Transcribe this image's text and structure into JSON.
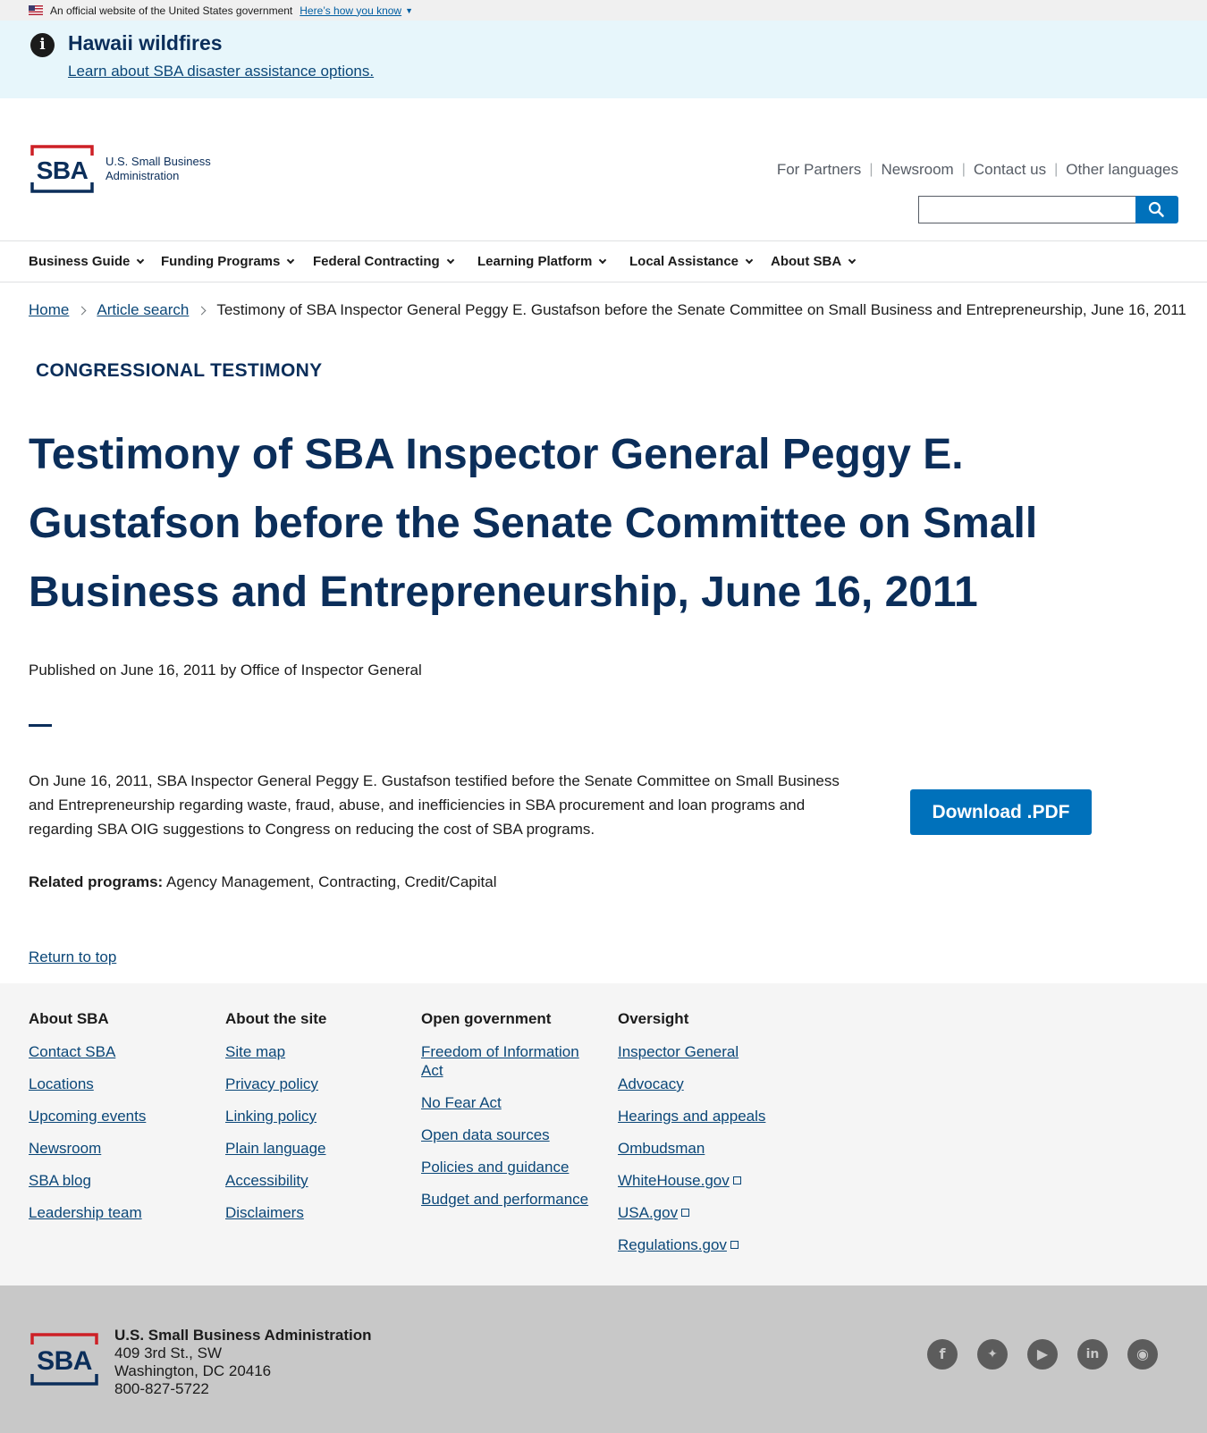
{
  "gov_banner": {
    "text": "An official website of the United States government",
    "link": "Here’s how you know"
  },
  "alert": {
    "title": "Hawaii wildfires",
    "link": "Learn about SBA disaster assistance options."
  },
  "header": {
    "logo_text_line1": "U.S. Small Business",
    "logo_text_line2": "Administration",
    "utility_nav": [
      "For Partners",
      "Newsroom",
      "Contact us",
      "Other languages"
    ],
    "search_placeholder": ""
  },
  "main_nav": [
    "Business Guide",
    "Funding Programs",
    "Federal Contracting",
    "Learning Platform",
    "Local Assistance",
    "About SBA"
  ],
  "breadcrumb": {
    "items": [
      "Home",
      "Article search"
    ],
    "current": "Testimony of SBA Inspector General Peggy E. Gustafson before the Senate Committee on Small Business and Entrepreneurship, June 16, 2011"
  },
  "article": {
    "eyebrow": "CONGRESSIONAL TESTIMONY",
    "title": "Testimony of SBA Inspector General Peggy E. Gustafson before the Senate Committee on Small Business and Entrepreneurship, June 16, 2011",
    "published": "Published on June 16, 2011 by Office of Inspector General",
    "summary": "On June 16, 2011, SBA Inspector General Peggy E. Gustafson testified before the Senate Committee on Small Business and Entrepreneurship regarding waste, fraud, abuse, and inefficiencies in SBA procurement and loan programs and regarding SBA OIG suggestions to Congress on reducing the cost of SBA programs.",
    "download_label": "Download .PDF",
    "related_label": "Related programs:",
    "related_value": "Agency Management, Contracting, Credit/Capital",
    "return_top": "Return to top"
  },
  "footer": {
    "columns": [
      {
        "title": "About SBA",
        "links": [
          "Contact SBA",
          "Locations",
          "Upcoming events",
          "Newsroom",
          "SBA blog",
          "Leadership team"
        ]
      },
      {
        "title": "About the site",
        "links": [
          "Site map",
          "Privacy policy",
          "Linking policy",
          "Plain language",
          "Accessibility",
          "Disclaimers"
        ]
      },
      {
        "title": "Open government",
        "links": [
          "Freedom of Information Act",
          "No Fear Act",
          "Open data sources",
          "Policies and guidance",
          "Budget and performance"
        ]
      },
      {
        "title": "Oversight",
        "links": [
          "Inspector General",
          "Advocacy",
          "Hearings and appeals",
          "Ombudsman",
          "WhiteHouse.gov",
          "USA.gov",
          "Regulations.gov"
        ]
      }
    ]
  },
  "bottom_footer": {
    "org": "U.S. Small Business Administration",
    "address1": "409 3rd St., SW",
    "address2": "Washington, DC 20416",
    "phone": "800-827-5722",
    "social_icons": [
      "facebook-icon",
      "twitter-icon",
      "youtube-icon",
      "linkedin-icon",
      "instagram-icon"
    ]
  },
  "colors": {
    "navy": "#0b2e5a",
    "primary": "#0071bb",
    "link": "#0b4778",
    "sba_red": "#cd2026"
  }
}
